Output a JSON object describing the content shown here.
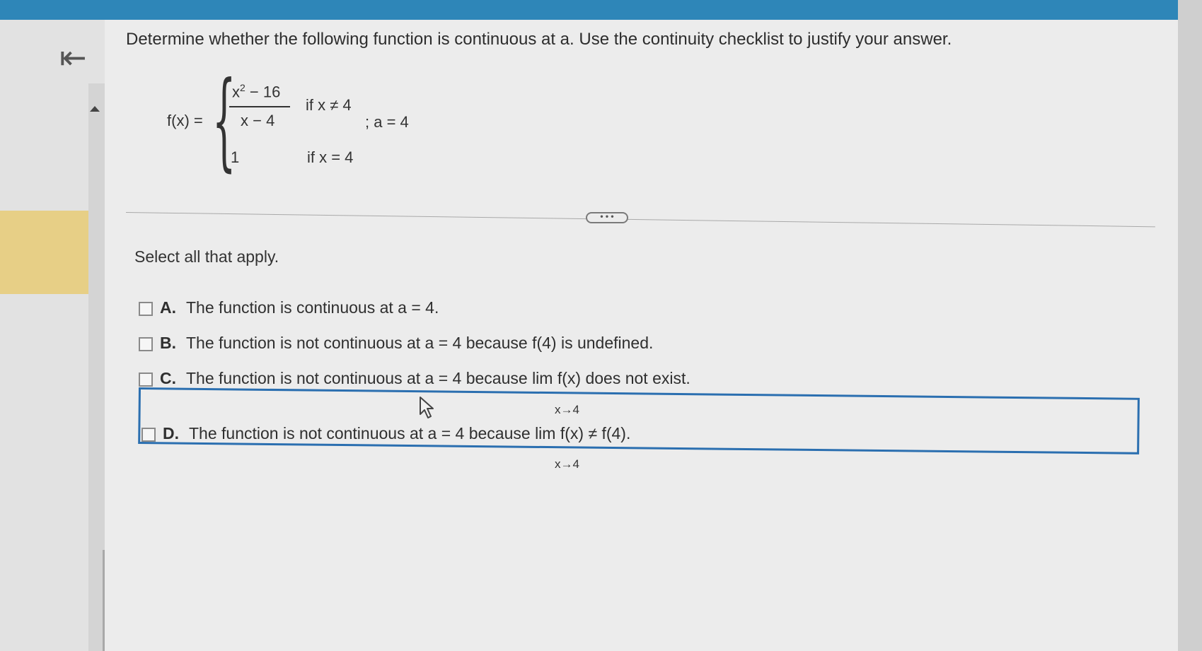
{
  "nav": {
    "back_icon": "back-to-start-icon",
    "back_glyph": "⇤"
  },
  "question": {
    "text": "Determine whether the following function is continuous at a. Use the continuity checklist to justify your answer."
  },
  "function": {
    "name": "f(x) =",
    "piece1_numerator": "x",
    "piece1_numerator_exp": "2",
    "piece1_numerator_rest": " − 16",
    "piece1_denominator": "x − 4",
    "piece1_condition": "if x ≠ 4",
    "piece2_value": "1",
    "piece2_condition": "if x = 4",
    "a_value": "; a = 4"
  },
  "more_button": "• • •",
  "instruction": "Select all that apply.",
  "options": [
    {
      "letter": "A.",
      "text": "The function is continuous at a = 4."
    },
    {
      "letter": "B.",
      "text": "The function is not continuous at a = 4 because f(4) is undefined."
    },
    {
      "letter": "C.",
      "text": "The function is not continuous at a = 4 because  lim f(x) does not exist.",
      "sub": "x→4"
    },
    {
      "letter": "D.",
      "text": "The function is not continuous at a = 4 because  lim f(x) ≠ f(4).",
      "sub": "x→4"
    }
  ],
  "colors": {
    "topbar": "#2e86b8",
    "focus": "#2b6fb0",
    "highlight": "#e7cf86"
  }
}
